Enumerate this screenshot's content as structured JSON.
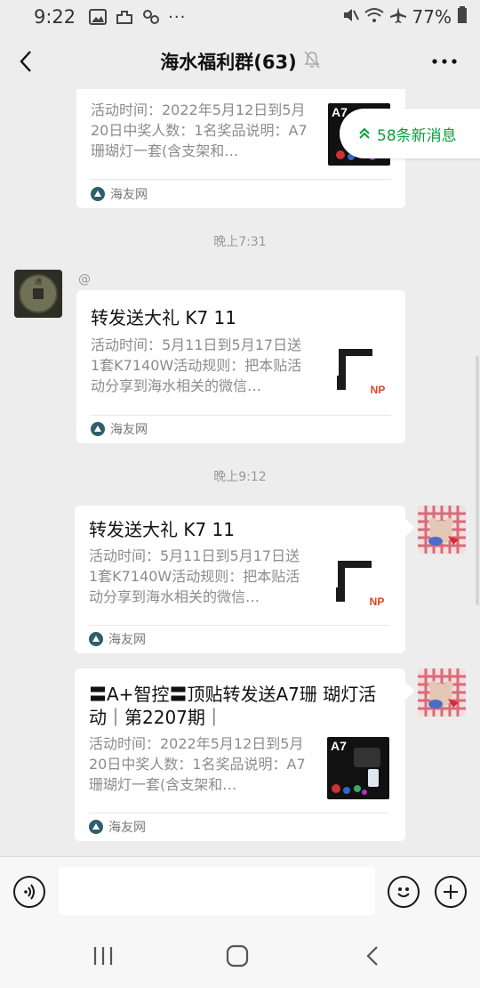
{
  "status_bar": {
    "time": "9:22",
    "battery": "77%",
    "more": "···"
  },
  "nav": {
    "title": "海水福利群(63)"
  },
  "new_messages": {
    "label": "58条新消息"
  },
  "messages": [
    {
      "desc": "活动时间：2022年5月12日到5月20日中奖人数：1名奖品说明：A7珊瑚灯一套(含支架和…",
      "source": "海友网",
      "thumb_text": "A7"
    },
    {
      "timestamp": "晚上7:31",
      "sender": "@",
      "title": "转发送大礼 K7 11",
      "desc": "活动时间：5月11日到5月17日送1套K7140W活动规则：把本贴活动分享到海水相关的微信…",
      "source": "海友网",
      "thumb_text": "NP"
    },
    {
      "timestamp": "晚上9:12",
      "title": "转发送大礼 K7 11",
      "desc": "活动时间：5月11日到5月17日送1套K7140W活动规则：把本贴活动分享到海水相关的微信…",
      "source": "海友网",
      "thumb_text": "NP"
    },
    {
      "title": "〓A+智控〓顶贴转发送A7珊 瑚灯活动｜第2207期｜",
      "desc": "活动时间：2022年5月12日到5月20日中奖人数：1名奖品说明：A7珊瑚灯一套(含支架和…",
      "source": "海友网",
      "thumb_text": "A7"
    }
  ],
  "input": {
    "placeholder": ""
  }
}
